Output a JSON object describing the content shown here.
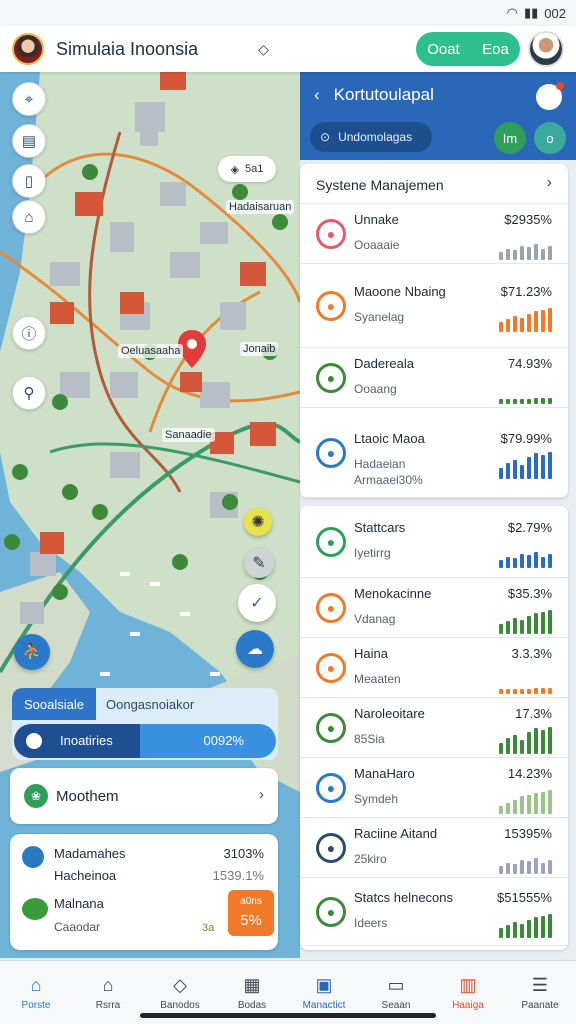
{
  "status_bar": {
    "signal_icons": "wifi signal battery",
    "text": "002"
  },
  "app_bar": {
    "title": "Simulaia Inoonsia",
    "pill": [
      "Ooat",
      "Eoa"
    ]
  },
  "map": {
    "chip": "5a1",
    "labels": [
      "Hadaisaruan",
      "Oeluasaaha",
      "Jonaib",
      "Sanaadie"
    ],
    "progress": {
      "tab_active": "Sooalsiale",
      "tab_inactive": "Oongasnoiakor",
      "label": "Inoatiries",
      "value_text": "0092%",
      "fraction": 0.48
    }
  },
  "cards": {
    "moothem": {
      "label": "Moothem"
    },
    "stats": [
      {
        "name": "Madamahes",
        "value": "3103%"
      },
      {
        "name": "Hacheinoa",
        "value": "1539.1%"
      },
      {
        "name": "Malnana",
        "sub": "Caaodar",
        "badge_top": "a0ns",
        "badge_main": "5%",
        "badge_left": "3a"
      }
    ]
  },
  "panel": {
    "title": "Kortutoulapal",
    "search": "Undomolagas",
    "c1": "Im",
    "c2": "o",
    "section_title": "Systene Manajemen",
    "rows_top": [
      {
        "name": "Unnake",
        "sub": "Ooaaaie",
        "value": "$2935%",
        "color": "#e35b66",
        "bar_color": "#9aa4b0"
      },
      {
        "name": "Maoone Nbaing",
        "sub": "Syanelag",
        "value": "$71.23%",
        "color": "#f07a2a",
        "bar_color": "#f07a2a"
      },
      {
        "name": "Dadereala",
        "sub": "Ooaang",
        "value": "74.93%",
        "color": "#3a8a3a",
        "bar_color": "#3a8a3a"
      },
      {
        "name": "Ltaoic Maoa",
        "sub": "Hadaeian",
        "sub2": "Armaael30%",
        "value": "$79.99%",
        "color": "#2a7ac2",
        "bar_color": "#2a6ac9"
      }
    ],
    "rows_bottom": [
      {
        "name": "Stattcars",
        "sub": "Iyetirrg",
        "value": "$2.79%",
        "color": "#2e9e5a",
        "bar_color": "#2a6ac9"
      },
      {
        "name": "Menokacinne",
        "sub": "Vdanag",
        "value": "$35.3%",
        "color": "#f07a2a",
        "bar_color": "#3a8a3a"
      },
      {
        "name": "Haina",
        "sub": "Meaaten",
        "value": "3.3.3%",
        "color": "#f07a2a",
        "bar_color": "#f07a2a"
      },
      {
        "name": "Naroleoitare",
        "sub": "85Sia",
        "value": "17.3%",
        "color": "#3a8a3a",
        "bar_color": "#3a8a3a"
      },
      {
        "name": "ManaHaro",
        "sub": "Symdeh",
        "value": "14.23%",
        "color": "#2a7ac2",
        "bar_color": "#9ac58a"
      },
      {
        "name": "Raciine Aitand",
        "sub": "25kiro",
        "value": "15395%",
        "color": "#2a4a6a",
        "bar_color": "#9aa4c0"
      },
      {
        "name": "Statcs helnecons",
        "sub": "Ideers",
        "value": "$51555%",
        "color": "#3a8a3a",
        "bar_color": "#3a8a3a"
      }
    ]
  },
  "bottom_nav": [
    "Porste",
    "Rsrra",
    "Banodos",
    "Bodas",
    "Manactict",
    "Seaan",
    "Haaiga",
    "Paanate"
  ]
}
